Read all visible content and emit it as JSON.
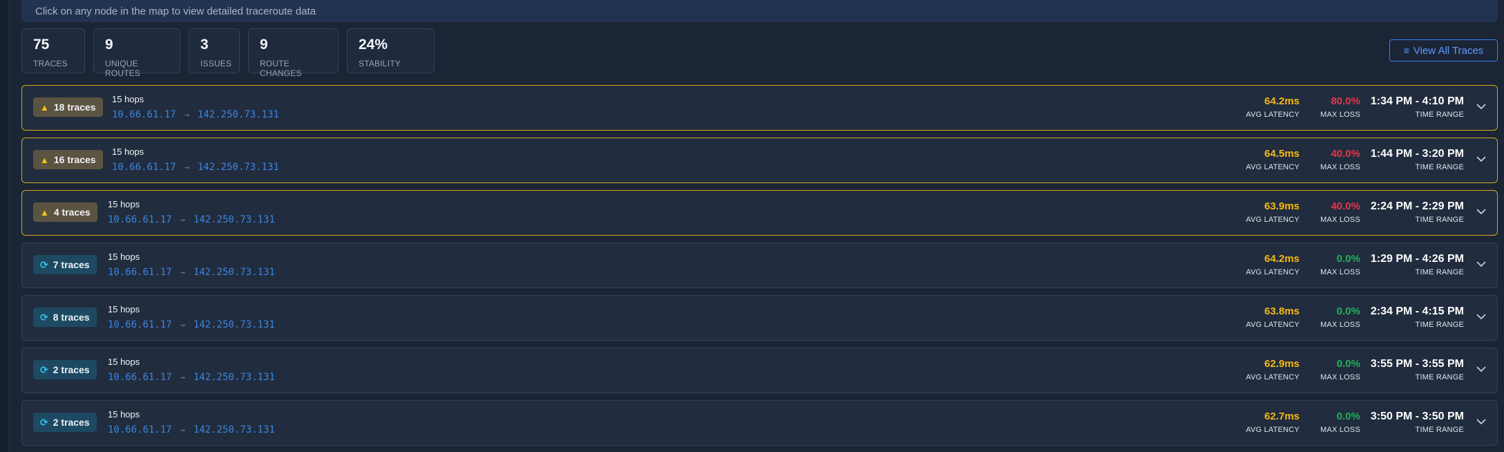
{
  "banner": {
    "text": "Click on any node in the map to view detailed traceroute data"
  },
  "stats": [
    {
      "value": "75",
      "label": "TRACES"
    },
    {
      "value": "9",
      "label": "UNIQUE ROUTES"
    },
    {
      "value": "3",
      "label": "ISSUES"
    },
    {
      "value": "9",
      "label": "ROUTE CHANGES"
    },
    {
      "value": "24%",
      "label": "STABILITY"
    }
  ],
  "view_all": {
    "label": "View All Traces",
    "icon": "list-icon"
  },
  "metric_labels": {
    "latency": "AVG LATENCY",
    "loss": "MAX LOSS",
    "time": "TIME RANGE"
  },
  "colors": {
    "warn_border": "#d4aa1f",
    "latency": "#f5b914",
    "loss_bad": "#e0394a",
    "loss_ok": "#22b05c",
    "ip": "#3b86e0"
  },
  "routes": [
    {
      "status": "warning",
      "badge": "18 traces",
      "hops": "15 hops",
      "src": "10.66.61.17",
      "dst": "142.250.73.131",
      "latency": "64.2ms",
      "loss": "80.0%",
      "time": "1:34 PM - 4:10 PM"
    },
    {
      "status": "warning",
      "badge": "16 traces",
      "hops": "15 hops",
      "src": "10.66.61.17",
      "dst": "142.250.73.131",
      "latency": "64.5ms",
      "loss": "40.0%",
      "time": "1:44 PM - 3:20 PM"
    },
    {
      "status": "warning",
      "badge": "4 traces",
      "hops": "15 hops",
      "src": "10.66.61.17",
      "dst": "142.250.73.131",
      "latency": "63.9ms",
      "loss": "40.0%",
      "time": "2:24 PM - 2:29 PM"
    },
    {
      "status": "ok",
      "badge": "7 traces",
      "hops": "15 hops",
      "src": "10.66.61.17",
      "dst": "142.250.73.131",
      "latency": "64.2ms",
      "loss": "0.0%",
      "time": "1:29 PM - 4:26 PM"
    },
    {
      "status": "ok",
      "badge": "8 traces",
      "hops": "15 hops",
      "src": "10.66.61.17",
      "dst": "142.250.73.131",
      "latency": "63.8ms",
      "loss": "0.0%",
      "time": "2:34 PM - 4:15 PM"
    },
    {
      "status": "ok",
      "badge": "2 traces",
      "hops": "15 hops",
      "src": "10.66.61.17",
      "dst": "142.250.73.131",
      "latency": "62.9ms",
      "loss": "0.0%",
      "time": "3:55 PM - 3:55 PM"
    },
    {
      "status": "ok",
      "badge": "2 traces",
      "hops": "15 hops",
      "src": "10.66.61.17",
      "dst": "142.250.73.131",
      "latency": "62.7ms",
      "loss": "0.0%",
      "time": "3:50 PM - 3:50 PM"
    }
  ]
}
